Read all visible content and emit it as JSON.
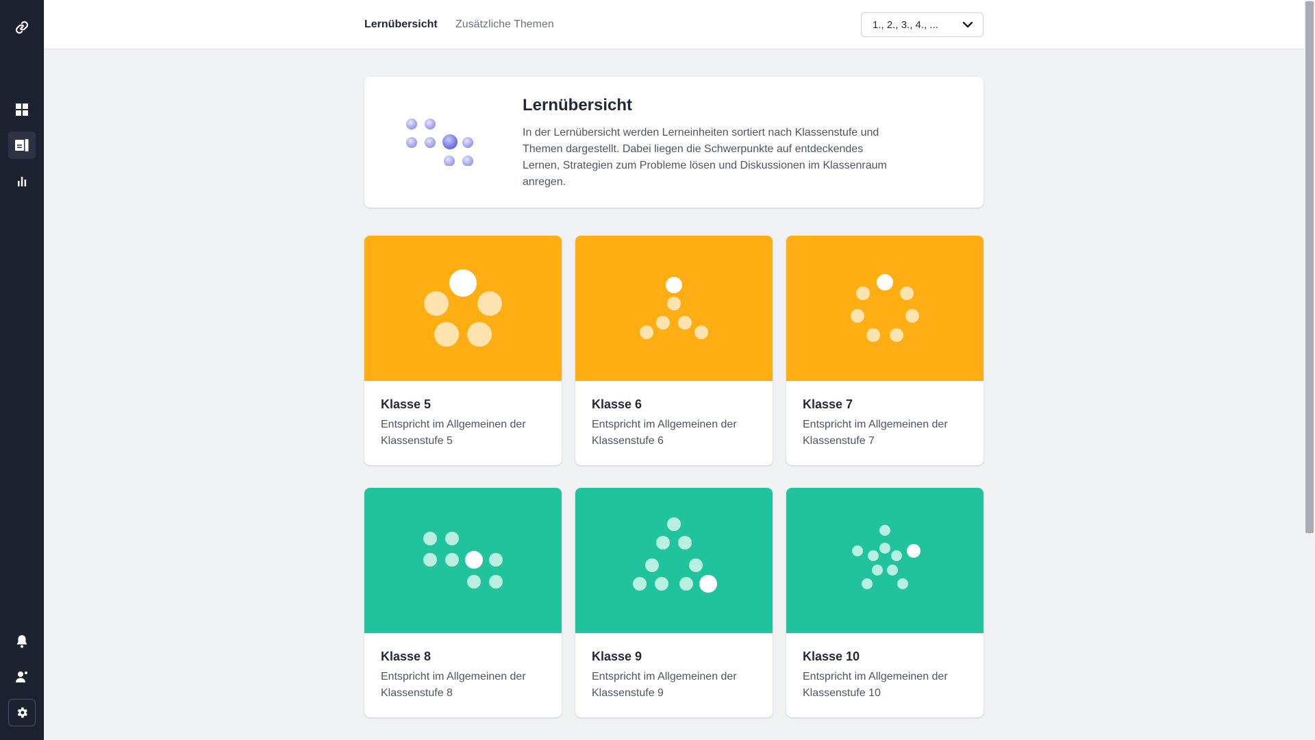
{
  "colors": {
    "sidebar_bg": "#1d2230",
    "orange": "#fead12",
    "teal": "#21c39d",
    "accent_purple": "#6466e0"
  },
  "sidebar": {
    "items": [
      {
        "icon": "link-logo-icon"
      },
      {
        "icon": "dashboard-grid-icon"
      },
      {
        "icon": "book-icon",
        "active": true
      },
      {
        "icon": "bar-chart-icon"
      },
      {
        "icon": "bell-icon"
      },
      {
        "icon": "user-icon"
      },
      {
        "icon": "gear-icon"
      }
    ]
  },
  "header": {
    "tabs": [
      {
        "label": "Lernübersicht",
        "active": true
      },
      {
        "label": "Zusätzliche Themen",
        "active": false
      }
    ],
    "grade_select": {
      "value": "1., 2., 3., 4., ..."
    }
  },
  "intro": {
    "title": "Lernübersicht",
    "text": "In der Lernübersicht werden Lerneinheiten sortiert nach Klassenstufe und Themen dargestellt. Dabei liegen die Schwerpunkte auf entdeckendes Lernen, Strategien zum Probleme lösen und Diskussionen im Klassenraum anregen."
  },
  "cards": [
    {
      "title": "Klasse 5",
      "desc": "Entspricht im Allgemeinen der Klassenstufe 5",
      "color": "orange"
    },
    {
      "title": "Klasse 6",
      "desc": "Entspricht im Allgemeinen der Klassenstufe 6",
      "color": "orange"
    },
    {
      "title": "Klasse 7",
      "desc": "Entspricht im Allgemeinen der Klassenstufe 7",
      "color": "orange"
    },
    {
      "title": "Klasse 8",
      "desc": "Entspricht im Allgemeinen der Klassenstufe 8",
      "color": "teal"
    },
    {
      "title": "Klasse 9",
      "desc": "Entspricht im Allgemeinen der Klassenstufe 9",
      "color": "teal"
    },
    {
      "title": "Klasse 10",
      "desc": "Entspricht im Allgemeinen der Klassenstufe 10",
      "color": "teal"
    }
  ]
}
